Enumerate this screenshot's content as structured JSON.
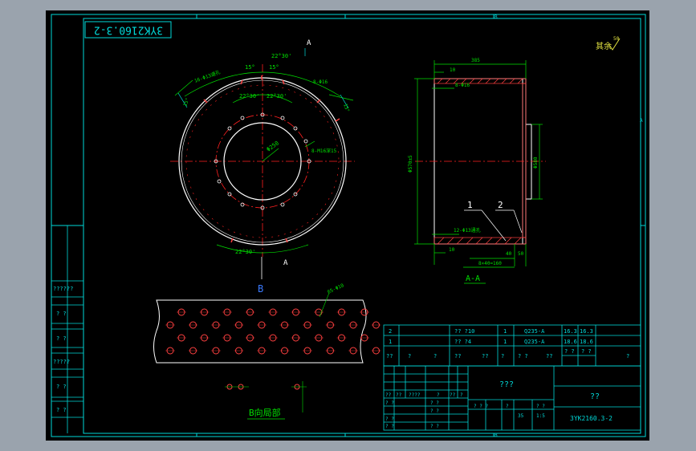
{
  "colors": {
    "background": "#000000",
    "frame": "#00d8d8",
    "dimension": "#00e000",
    "centerline": "#ff2020",
    "outline": "#ffffff",
    "hatch": "#ff4040",
    "section_label": "#3a7aff",
    "text_yellow": "#e0e040",
    "surface_mark": "#e0e040"
  },
  "frame": {
    "zone_top_b": "B",
    "zone_bottom_b": "B",
    "zone_right_a": "A"
  },
  "drawing_number_stamp": "3YK2160.3-2",
  "surface_finish": {
    "label": "其余",
    "value": "50"
  },
  "front_view": {
    "dim_top_angle": "22°30'",
    "dim_top_small": "15°",
    "dim_top_small2": "15°",
    "dim_inner_left": "22°30'",
    "dim_inner_right": "22°30'",
    "dim_bottom_angle": "22°30'",
    "holes_left": "16-Φ13通孔",
    "holes_right": "8-Φ16",
    "holes_inner": "8-M16深15",
    "dim_diameter": "Φ250",
    "dim_left_small": "15°",
    "dim_right_small": "15°",
    "section_a_top": "A",
    "section_a_bottom": "A",
    "view_b": "B"
  },
  "section_view": {
    "dim_top_width": "385",
    "dim_top_small": "10",
    "dim_holes_top": "8-Φ16",
    "dim_left_dia": "Φ570±5",
    "dim_right_dia": "Φ580",
    "dim_holes_bottom": "12-Φ13通孔",
    "dim_bottom_10": "10",
    "dim_bottom_40": "40",
    "dim_bottom_50": "50",
    "dim_bottom_chain": "8×40=160",
    "label_1": "1",
    "label_2": "2",
    "title": "A-A"
  },
  "b_view": {
    "title": "B向局部",
    "holes_label": "65-Φ10"
  },
  "left_sidebar": {
    "labels": [
      "??????",
      "?  ?",
      "?  ?",
      "?????",
      "?  ?",
      "?  ?"
    ]
  },
  "bom": {
    "rows": [
      [
        "2",
        "",
        "?? ?10",
        "1",
        "Q235-A",
        "16.3",
        "16.3",
        ""
      ],
      [
        "1",
        "",
        "?? ?4",
        "1",
        "Q235-A",
        "18.6",
        "18.6",
        ""
      ]
    ],
    "header": [
      "??",
      "?",
      "?",
      "??",
      "??",
      "?",
      "? ?",
      "??",
      "?"
    ],
    "header_sub": [
      "? ?",
      "? ?"
    ]
  },
  "title_block": {
    "part_name": "???",
    "company": "??",
    "drawing_number": "3YK2160.3-2",
    "scale": "1:5",
    "weight": "35",
    "cells_a": [
      "??",
      "??",
      "????",
      "?",
      "??",
      "?"
    ],
    "cells_b": [
      "? ?",
      "? ?",
      "? ?",
      "? ?"
    ],
    "cells_c": [
      "? ? ?",
      "?",
      "? ?"
    ],
    "cells_d": [
      "? ?",
      "? ?"
    ]
  }
}
